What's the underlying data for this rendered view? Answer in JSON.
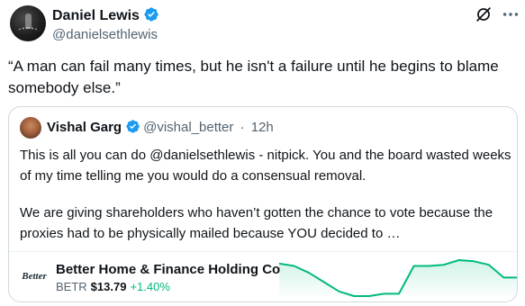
{
  "author": {
    "name": "Daniel Lewis",
    "handle": "@danielsethlewis",
    "verified": true
  },
  "tweet": {
    "text": "“A man can fail many times, but he isn't a failure until he begins to blame somebody else.”"
  },
  "quoted": {
    "name": "Vishal Garg",
    "handle": "@vishal_better",
    "separator": "·",
    "time": "12h",
    "verified": true,
    "paragraph1": "This is all you can do @danielsethlewis - nitpick. You and the board wasted weeks of my time telling me you would do a consensual removal.",
    "paragraph2": "We are giving shareholders who haven’t gotten the chance to vote because the proxies had to be physically mailed because YOU decided to …"
  },
  "stock": {
    "logo_text": "Better",
    "company": "Better Home & Finance Holding Co",
    "ticker": "BETR",
    "price": "$13.79",
    "change": "+1.40%",
    "trend_color": "#00ba7c",
    "sparkline_values": [
      13.75,
      13.74,
      13.71,
      13.67,
      13.63,
      13.61,
      13.61,
      13.62,
      13.62,
      13.74,
      13.74,
      13.745,
      13.765,
      13.76,
      13.745,
      13.69,
      13.69
    ]
  },
  "icons": {
    "verified": "verified-badge-icon",
    "mute": "mute-icon",
    "more": "more-icon"
  },
  "colors": {
    "text": "#0f1419",
    "secondary": "#536471",
    "verified_blue": "#1d9bf0",
    "border": "#cfd9de"
  }
}
